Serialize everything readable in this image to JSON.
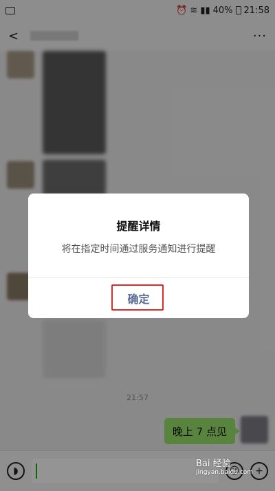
{
  "status": {
    "battery": "40%",
    "time": "21:58"
  },
  "chat": {
    "timestamp": "21:57",
    "my_message": "晚上 7 点见"
  },
  "dialog": {
    "title": "提醒详情",
    "body": "将在指定时间通过服务通知进行提醒",
    "confirm_label": "确定"
  },
  "watermark": {
    "main": "Bai 经验",
    "sub": "jingyan.baidu.com"
  },
  "icons": {
    "back": "chevron-left-icon",
    "more": "more-icon",
    "voice": "voice-icon",
    "emoji": "emoji-icon",
    "add": "plus-icon"
  },
  "colors": {
    "accent": "#576b95",
    "my_bubble": "#9ae36a",
    "highlight": "#e02a2a"
  }
}
